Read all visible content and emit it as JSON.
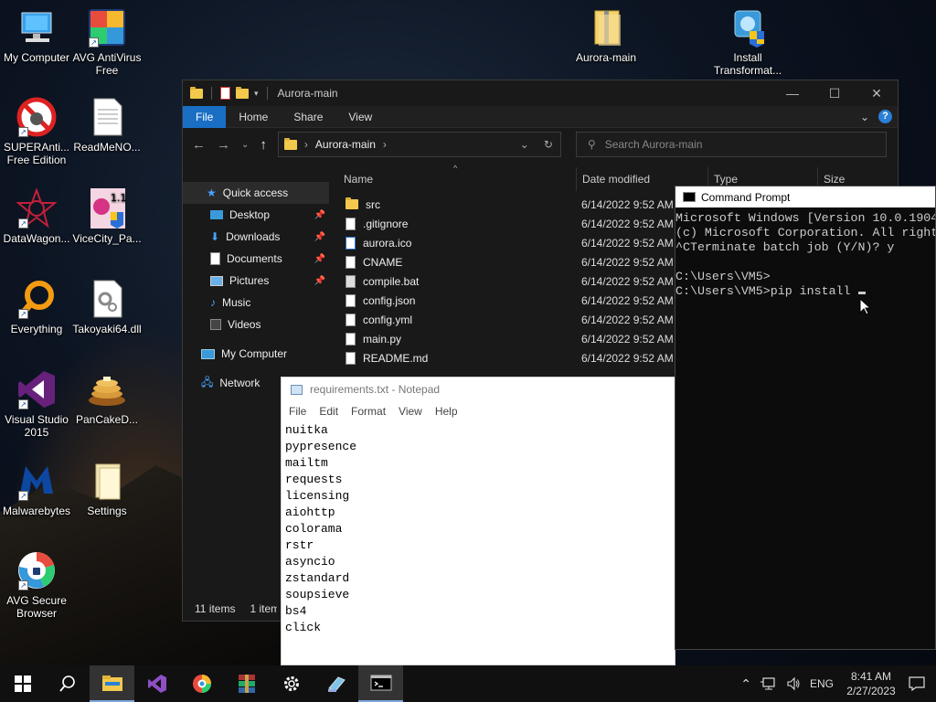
{
  "desktop": {
    "icons": [
      {
        "label": "My Computer",
        "icon": "my-computer-icon"
      },
      {
        "label": "AVG AntiVirus Free",
        "icon": "avg-antivirus-icon"
      },
      {
        "label": "SUPERAnti... Free Edition",
        "icon": "superantispyware-icon"
      },
      {
        "label": "ReadMeNO...",
        "icon": "text-document-icon"
      },
      {
        "label": "DataWagon...",
        "icon": "datawagon-icon"
      },
      {
        "label": "ViceCity_Pa...",
        "icon": "vicecity-icon"
      },
      {
        "label": "Everything",
        "icon": "everything-search-icon"
      },
      {
        "label": "Takoyaki64.dll",
        "icon": "dll-file-icon"
      },
      {
        "label": "Visual Studio 2015",
        "icon": "visual-studio-icon"
      },
      {
        "label": "PanCakeD...",
        "icon": "pancake-icon"
      },
      {
        "label": "Malwarebytes",
        "icon": "malwarebytes-icon"
      },
      {
        "label": "Settings",
        "icon": "settings-folder-icon"
      },
      {
        "label": "AVG Secure Browser",
        "icon": "avg-browser-icon"
      },
      {
        "label": "Aurora-main",
        "icon": "zip-folder-icon"
      },
      {
        "label": "Install Transformat...",
        "icon": "installer-icon"
      }
    ]
  },
  "explorer": {
    "title": "Aurora-main",
    "tabs": [
      "File",
      "Home",
      "Share",
      "View"
    ],
    "address": "Aurora-main",
    "search_placeholder": "Search Aurora-main",
    "columns": {
      "name": "Name",
      "date": "Date modified",
      "type": "Type",
      "size": "Size"
    },
    "nav": {
      "quick_access": "Quick access",
      "items": [
        "Desktop",
        "Downloads",
        "Documents",
        "Pictures",
        "Music",
        "Videos"
      ],
      "my_computer": "My Computer",
      "network": "Network"
    },
    "files": [
      {
        "name": "src",
        "date": "6/14/2022 9:52 AM",
        "kind": "folder"
      },
      {
        "name": ".gitignore",
        "date": "6/14/2022 9:52 AM",
        "kind": "file"
      },
      {
        "name": "aurora.ico",
        "date": "6/14/2022 9:52 AM",
        "kind": "file"
      },
      {
        "name": "CNAME",
        "date": "6/14/2022 9:52 AM",
        "kind": "file"
      },
      {
        "name": "compile.bat",
        "date": "6/14/2022 9:52 AM",
        "kind": "file"
      },
      {
        "name": "config.json",
        "date": "6/14/2022 9:52 AM",
        "kind": "file"
      },
      {
        "name": "config.yml",
        "date": "6/14/2022 9:52 AM",
        "kind": "file"
      },
      {
        "name": "main.py",
        "date": "6/14/2022 9:52 AM",
        "kind": "file"
      },
      {
        "name": "README.md",
        "date": "6/14/2022 9:52 AM",
        "kind": "file"
      }
    ],
    "status_count": "11 items",
    "status_selected": "1 item"
  },
  "notepad": {
    "title": "requirements.txt - Notepad",
    "menu": [
      "File",
      "Edit",
      "Format",
      "View",
      "Help"
    ],
    "lines": [
      "nuitka",
      "pypresence",
      "mailtm",
      "requests",
      "licensing",
      "aiohttp",
      "colorama",
      "rstr",
      "asyncio",
      "zstandard",
      "soupsieve",
      "bs4",
      "click"
    ]
  },
  "cmd": {
    "title": "Command Prompt",
    "lines": [
      "Microsoft Windows [Version 10.0.1904",
      "(c) Microsoft Corporation. All right",
      "^CTerminate batch job (Y/N)? y",
      "",
      "C:\\Users\\VM5>",
      "C:\\Users\\VM5>pip install "
    ]
  },
  "taskbar": {
    "language": "ENG",
    "time": "8:41 AM",
    "date": "2/27/2023"
  }
}
